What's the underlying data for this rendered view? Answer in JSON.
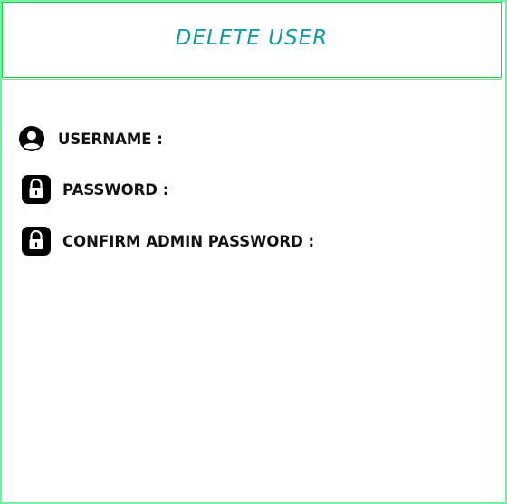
{
  "header": {
    "title": "DELETE USER"
  },
  "form": {
    "fields": [
      {
        "label": "USERNAME :",
        "icon": "user-icon"
      },
      {
        "label": "PASSWORD :",
        "icon": "lock-icon"
      },
      {
        "label": "CONFIRM ADMIN PASSWORD :",
        "icon": "lock-icon"
      }
    ]
  },
  "colors": {
    "border": "#6ff0a2",
    "header_border": "#1fcf4a",
    "title": "#149c9c",
    "label": "#111111"
  }
}
